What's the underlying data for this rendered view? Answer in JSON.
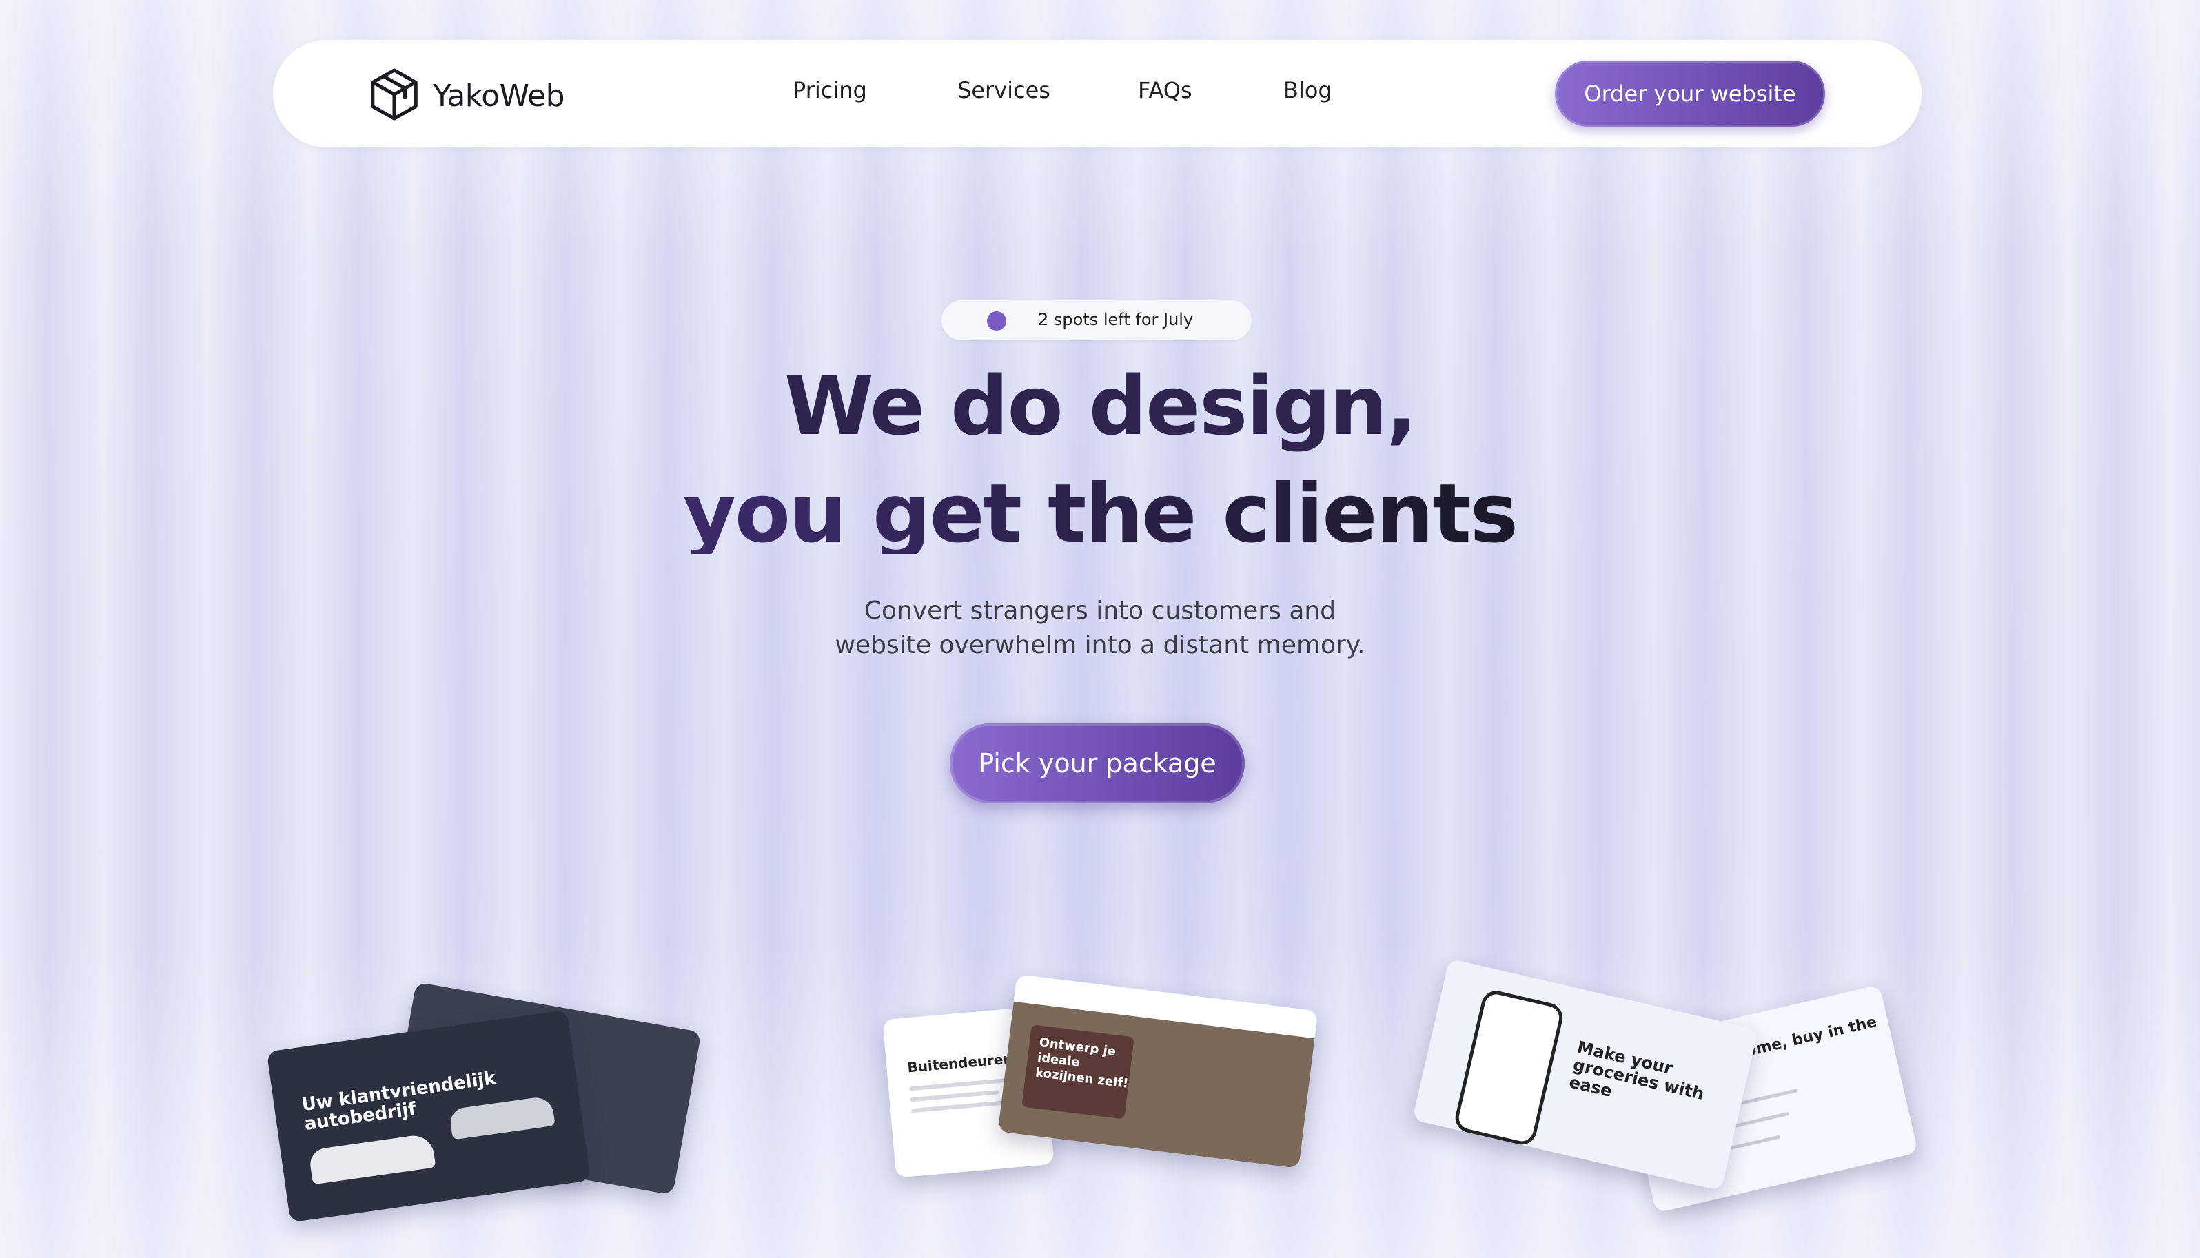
{
  "brand": {
    "name": "YakoWeb",
    "logo_icon": "cube-icon"
  },
  "nav": {
    "links": [
      "Pricing",
      "Services",
      "FAQs",
      "Blog"
    ],
    "cta": "Order your website"
  },
  "hero": {
    "badge": "2 spots left for July",
    "title_line1": "We do design,",
    "title_line2": "you get the clients",
    "subtitle_line1": "Convert strangers into customers and",
    "subtitle_line2": "website overwhelm into a distant memory.",
    "cta": "Pick your package"
  },
  "showcase": {
    "autobedrijf": {
      "headline": "Uw klantvriendelijk autobedrijf"
    },
    "kozijnen": {
      "page_title": "Buitendeuren",
      "headline": "Ontwerp je ideale kozijnen zelf!"
    },
    "groceries": {
      "headline": "Make your groceries with ease",
      "headline2": "groceries home, buy in the store"
    }
  },
  "colors": {
    "accent": "#7a5bc4",
    "accent_dark": "#5a3d9c",
    "title": "#2f2450"
  }
}
